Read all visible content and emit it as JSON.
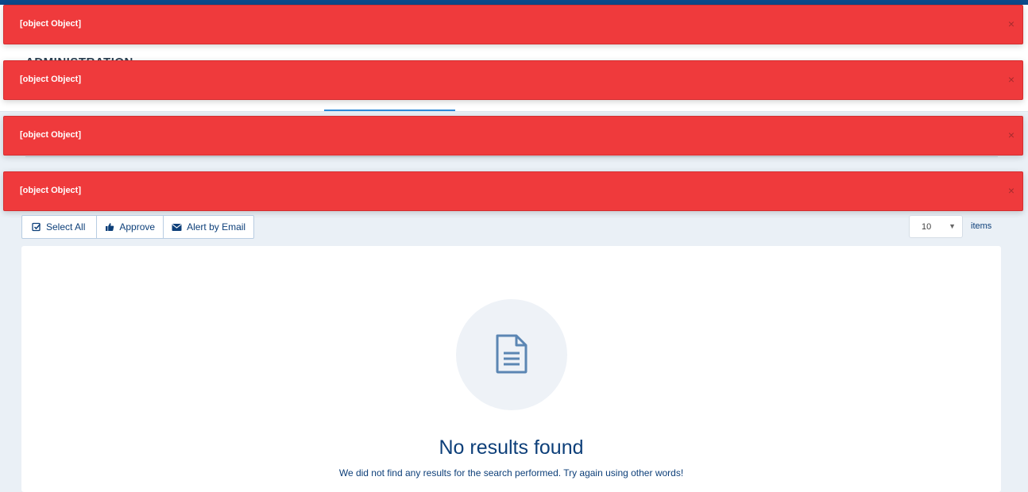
{
  "page": {
    "title": "ADMINISTRATION"
  },
  "toasts": [
    {
      "message": "[object Object]",
      "close": "×"
    },
    {
      "message": "[object Object]",
      "close": "×"
    },
    {
      "message": "[object Object]",
      "close": "×"
    },
    {
      "message": "[object Object]",
      "close": "×"
    }
  ],
  "toolbar": {
    "select_all_label": "Select All",
    "approve_label": "Approve",
    "alert_email_label": "Alert by Email",
    "select_all_icon": "check-square-icon",
    "approve_icon": "thumbs-up-icon",
    "alert_email_icon": "envelope-icon"
  },
  "pagination": {
    "page_size": "10",
    "items_label": "items"
  },
  "empty_state": {
    "icon": "document-icon",
    "title": "No results found",
    "message": "We did not find any results for the search performed. Try again using other words!"
  },
  "colors": {
    "toast_bg": "#ef3a3c",
    "primary_text": "#0d3f79",
    "topbar": "#0b4a8a",
    "active_tab": "#2f8ad8"
  }
}
